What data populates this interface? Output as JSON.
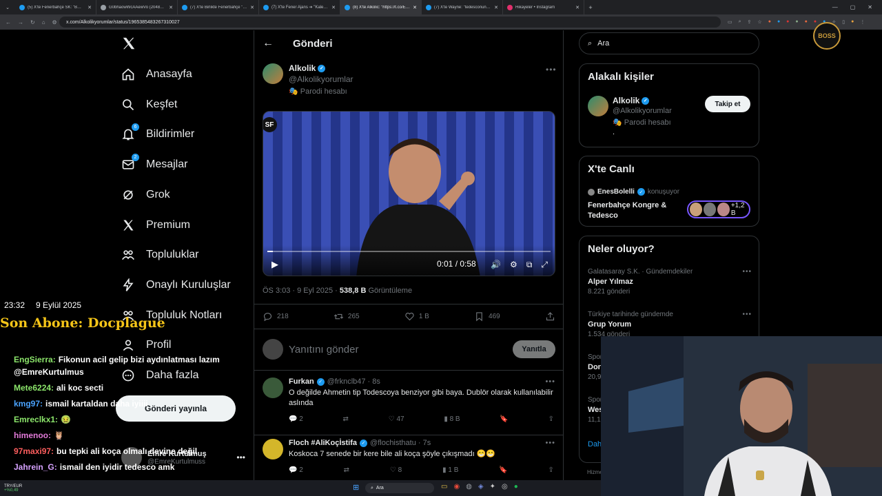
{
  "browser": {
    "tabs": [
      {
        "label": "(5) X'te Fenerbahçe SK: \"B…",
        "color": "#1d9bf0"
      },
      {
        "label": "G0bhaowWcAAewVo (2048×1…",
        "color": "#9aa0a6"
      },
      {
        "label": "(7) X'te Birlikte Fenerbahçe \"…",
        "color": "#1d9bf0"
      },
      {
        "label": "(7) X'te Fener Ajans ➔ \"Kaleci…",
        "color": "#1d9bf0"
      },
      {
        "label": "(8) X'te Alkolic: \"https://t.co/E…",
        "color": "#1d9bf0"
      },
      {
        "label": "(7) X'te Wayne: \"tedesconun s…",
        "color": "#1d9bf0"
      },
      {
        "label": "Hikayeler • Instagram",
        "color": "#e1306c"
      }
    ],
    "url": "x.com/Alkolikyorumlar/status/1965385483267310027"
  },
  "nav": {
    "items": [
      {
        "label": "Anasayfa",
        "icon": "home-icon"
      },
      {
        "label": "Keşfet",
        "icon": "search-icon"
      },
      {
        "label": "Bildirimler",
        "icon": "bell-icon",
        "badge": "6"
      },
      {
        "label": "Mesajlar",
        "icon": "mail-icon",
        "badge": "2"
      },
      {
        "label": "Grok",
        "icon": "grok-icon"
      },
      {
        "label": "Premium",
        "icon": "x-premium-icon"
      },
      {
        "label": "Topluluklar",
        "icon": "people-icon"
      },
      {
        "label": "Onaylı Kuruluşlar",
        "icon": "bolt-icon"
      },
      {
        "label": "Topluluk Notları",
        "icon": "notes-icon"
      },
      {
        "label": "Profil",
        "icon": "person-icon"
      },
      {
        "label": "Daha fazla",
        "icon": "more-circle-icon"
      }
    ],
    "post_button": "Gönderi yayınla",
    "account_name": "Emre Kurtulmuş",
    "account_handle": "@EmreKurtulmuss"
  },
  "overlay": {
    "time": "23:32",
    "date": "9 Eylül 2025",
    "sub_banner": "Son Abone: Docplague",
    "chat": [
      {
        "user": "EngSierra:",
        "color": "#8ce66b",
        "text": "Fikonun acil gelip bizi aydınlatması lazım @EmreKurtulmus"
      },
      {
        "user": "Mete6224:",
        "color": "#8ce66b",
        "text": "ali koc secti"
      },
      {
        "user": "kmg97:",
        "color": "#4aa3ff",
        "text": "ismail kartaldan daha iyiiii"
      },
      {
        "user": "Emreclkx1:",
        "color": "#8ce66b",
        "text": "🤢"
      },
      {
        "user": "himenoo:",
        "color": "#e27ad8",
        "text": "🦉"
      },
      {
        "user": "97maxi97:",
        "color": "#ff5e5e",
        "text": "bu tepki ali koça olmalı devine değil"
      },
      {
        "user": "Jahrein_G:",
        "color": "#d6a2ff",
        "text": "ismail den iyidir tedesco amk"
      }
    ]
  },
  "post": {
    "header": "Gönderi",
    "author_name": "Alkolik",
    "author_handle": "@Alkolikyorumlar",
    "parody": "Parodi hesabı",
    "video_time": "0:01 / 0:58",
    "video_progress": 0.02,
    "video_badge": "SF",
    "timestamp": "ÖS 3:03 · 9 Eyl 2025 · ",
    "views": "538,8 B",
    "views_label": " Görüntüleme",
    "replies": "218",
    "reposts": "265",
    "likes": "1 B",
    "bookmarks": "469",
    "reply_placeholder": "Yanıtını gönder",
    "reply_button": "Yanıtla"
  },
  "replies": [
    {
      "name": "Furkan",
      "handle": "@frknclb47 · 8s",
      "text": "O değilde Ahmetin tip Todescoya benziyor gibi baya. Dublör olarak kullanılabilir aslında",
      "replies": "2",
      "likes": "47",
      "views": "8 B",
      "avatar_color": "#3a5a3a"
    },
    {
      "name": "Floch #AliKoçİstifa",
      "handle": "@flochisthatu · 7s",
      "text": "Koskoca 7 senede bir kere bile ali koça şöyle çıkışmadı 😁😁",
      "replies": "2",
      "likes": "8",
      "views": "1 B",
      "avatar_color": "#d4b62a"
    }
  ],
  "right": {
    "search_placeholder": "Ara",
    "people_title": "Alakalı kişiler",
    "person_name": "Alkolik",
    "person_handle": "@Alkolikyorumlar",
    "person_parody": "Parodi hesabı",
    "person_bio": ".",
    "follow_button": "Takip et",
    "live_title": "X'te Canlı",
    "live_host": "EnesBolelli",
    "live_status": "konuşuyor",
    "live_topic": "Fenerbahçe Kongre & Tedesco",
    "live_count": "+1,2 B",
    "trends_title": "Neler oluyor?",
    "trends": [
      {
        "context": "Galatasaray S.K. · Gündemdekiler",
        "name": "Alper Yılmaz",
        "count": "8.221 gönderi"
      },
      {
        "context": "Türkiye tarihinde gündemde",
        "name": "Grup Yorum",
        "count": "1.534 gönderi"
      },
      {
        "context": "Spor",
        "name": "Don",
        "count": "20,9"
      },
      {
        "context": "Spor",
        "name": "Wes",
        "count": "11,1 B"
      }
    ],
    "show_more": "Dah",
    "footer": "Hizme"
  },
  "taskbar": {
    "pair": "TRY/EUR",
    "change": "+%0,49",
    "search": "Ara"
  },
  "stream_logo": "BOSS"
}
